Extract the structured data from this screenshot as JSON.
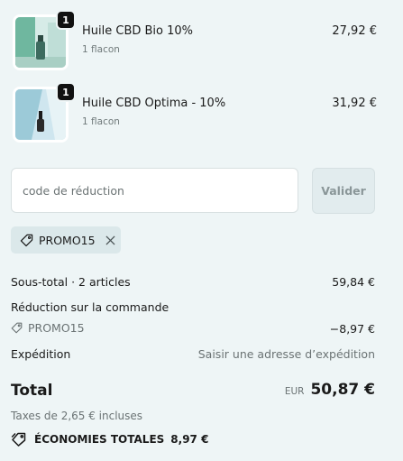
{
  "products": [
    {
      "quantity": "1",
      "name": "Huile CBD Bio 10%",
      "variant": "1 flacon",
      "price": "27,92 €",
      "image_icon": "cbd-bottle-image"
    },
    {
      "quantity": "1",
      "name": "Huile CBD Optima - 10%",
      "variant": "1 flacon",
      "price": "31,92 €",
      "image_icon": "cbd-dropper-image"
    }
  ],
  "discount": {
    "placeholder": "code de réduction",
    "apply_label": "Valider",
    "applied_code": "PROMO15"
  },
  "summary": {
    "subtotal_label": "Sous-total · 2 articles",
    "subtotal_value": "59,84 €",
    "order_discount_label": "Réduction sur la commande",
    "order_discount_code": "PROMO15",
    "order_discount_value": "−8,97 €",
    "shipping_label": "Expédition",
    "shipping_value": "Saisir une adresse d’expédition",
    "total_label": "Total",
    "total_currency": "EUR",
    "total_value": "50,87 €",
    "taxes_note": "Taxes de 2,65 € incluses",
    "savings_label": "ÉCONOMIES TOTALES",
    "savings_value": "8,97 €"
  },
  "colors": {
    "background": "#eef5f6",
    "tag_background": "#dbe8ea",
    "muted_text": "#6b7374"
  }
}
